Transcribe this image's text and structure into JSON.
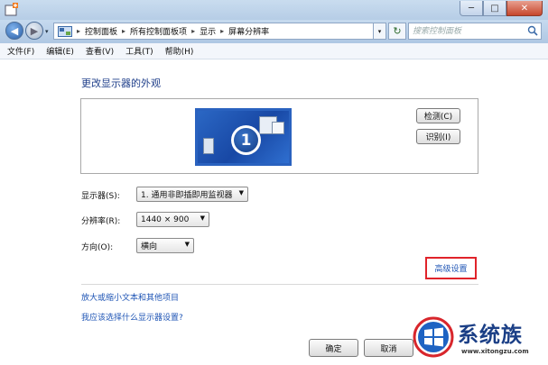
{
  "window": {
    "minimize": "─",
    "maximize": "□",
    "close": "✕"
  },
  "address_bar": {
    "crumbs": [
      "控制面板",
      "所有控制面板项",
      "显示",
      "屏幕分辨率"
    ],
    "separator": "▸",
    "drop": "▾",
    "refresh": "↻"
  },
  "search": {
    "placeholder": "搜索控制面板"
  },
  "menu": [
    "文件(F)",
    "编辑(E)",
    "查看(V)",
    "工具(T)",
    "帮助(H)"
  ],
  "main": {
    "title": "更改显示器的外观",
    "monitor_number": "1",
    "detect_label": "检测(C)",
    "identify_label": "识别(I)",
    "display_label": "显示器(S):",
    "display_value": "1. 通用非即插即用监视器",
    "resolution_label": "分辨率(R):",
    "resolution_value": "1440 × 900",
    "orientation_label": "方向(O):",
    "orientation_value": "横向",
    "advanced_link": "高级设置",
    "link_text_size": "放大或缩小文本和其他项目",
    "link_which_settings": "我应该选择什么显示器设置?",
    "ok_label": "确定",
    "cancel_label": "取消"
  },
  "watermark": {
    "brand": "系统族",
    "url": "www.xitongzu.com"
  },
  "colors": {
    "accent_link": "#1f55b5",
    "title_blue": "#1f3f8a",
    "highlight_red": "#e0232a",
    "monitor_blue": "#2a62bf"
  }
}
